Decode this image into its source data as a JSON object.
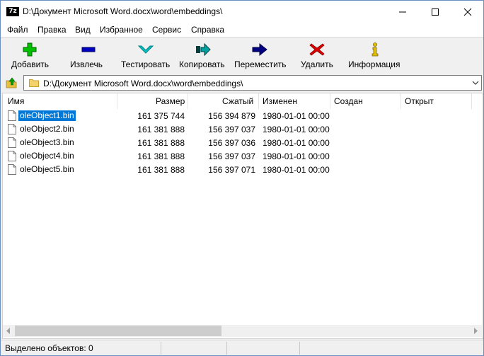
{
  "window": {
    "app_icon_text": "7z",
    "title": "D:\\Документ Microsoft Word.docx\\word\\embeddings\\"
  },
  "menu": [
    "Файл",
    "Правка",
    "Вид",
    "Избранное",
    "Сервис",
    "Справка"
  ],
  "toolbar": [
    {
      "label": "Добавить",
      "icon": "plus-icon",
      "color": "#00c000"
    },
    {
      "label": "Извлечь",
      "icon": "minus-icon",
      "color": "#0000c0"
    },
    {
      "label": "Тестировать",
      "icon": "check-chevron-icon",
      "color": "#00c8c8"
    },
    {
      "label": "Копировать",
      "icon": "copy-arrow-icon",
      "color": "#008080"
    },
    {
      "label": "Переместить",
      "icon": "move-arrow-icon",
      "color": "#000080"
    },
    {
      "label": "Удалить",
      "icon": "delete-x-icon",
      "color": "#e00000"
    },
    {
      "label": "Информация",
      "icon": "info-icon",
      "color": "#e0c000"
    }
  ],
  "address": {
    "path": "D:\\Документ Microsoft Word.docx\\word\\embeddings\\"
  },
  "columns": [
    "Имя",
    "Размер",
    "Сжатый",
    "Изменен",
    "Создан",
    "Открыт"
  ],
  "files": [
    {
      "name": "oleObject1.bin",
      "size": "161 375 744",
      "packed": "156 394 879",
      "modified": "1980-01-01 00:00",
      "selected": true
    },
    {
      "name": "oleObject2.bin",
      "size": "161 381 888",
      "packed": "156 397 037",
      "modified": "1980-01-01 00:00",
      "selected": false
    },
    {
      "name": "oleObject3.bin",
      "size": "161 381 888",
      "packed": "156 397 036",
      "modified": "1980-01-01 00:00",
      "selected": false
    },
    {
      "name": "oleObject4.bin",
      "size": "161 381 888",
      "packed": "156 397 037",
      "modified": "1980-01-01 00:00",
      "selected": false
    },
    {
      "name": "oleObject5.bin",
      "size": "161 381 888",
      "packed": "156 397 071",
      "modified": "1980-01-01 00:00",
      "selected": false
    }
  ],
  "status": {
    "selected_text": "Выделено объектов: 0"
  }
}
